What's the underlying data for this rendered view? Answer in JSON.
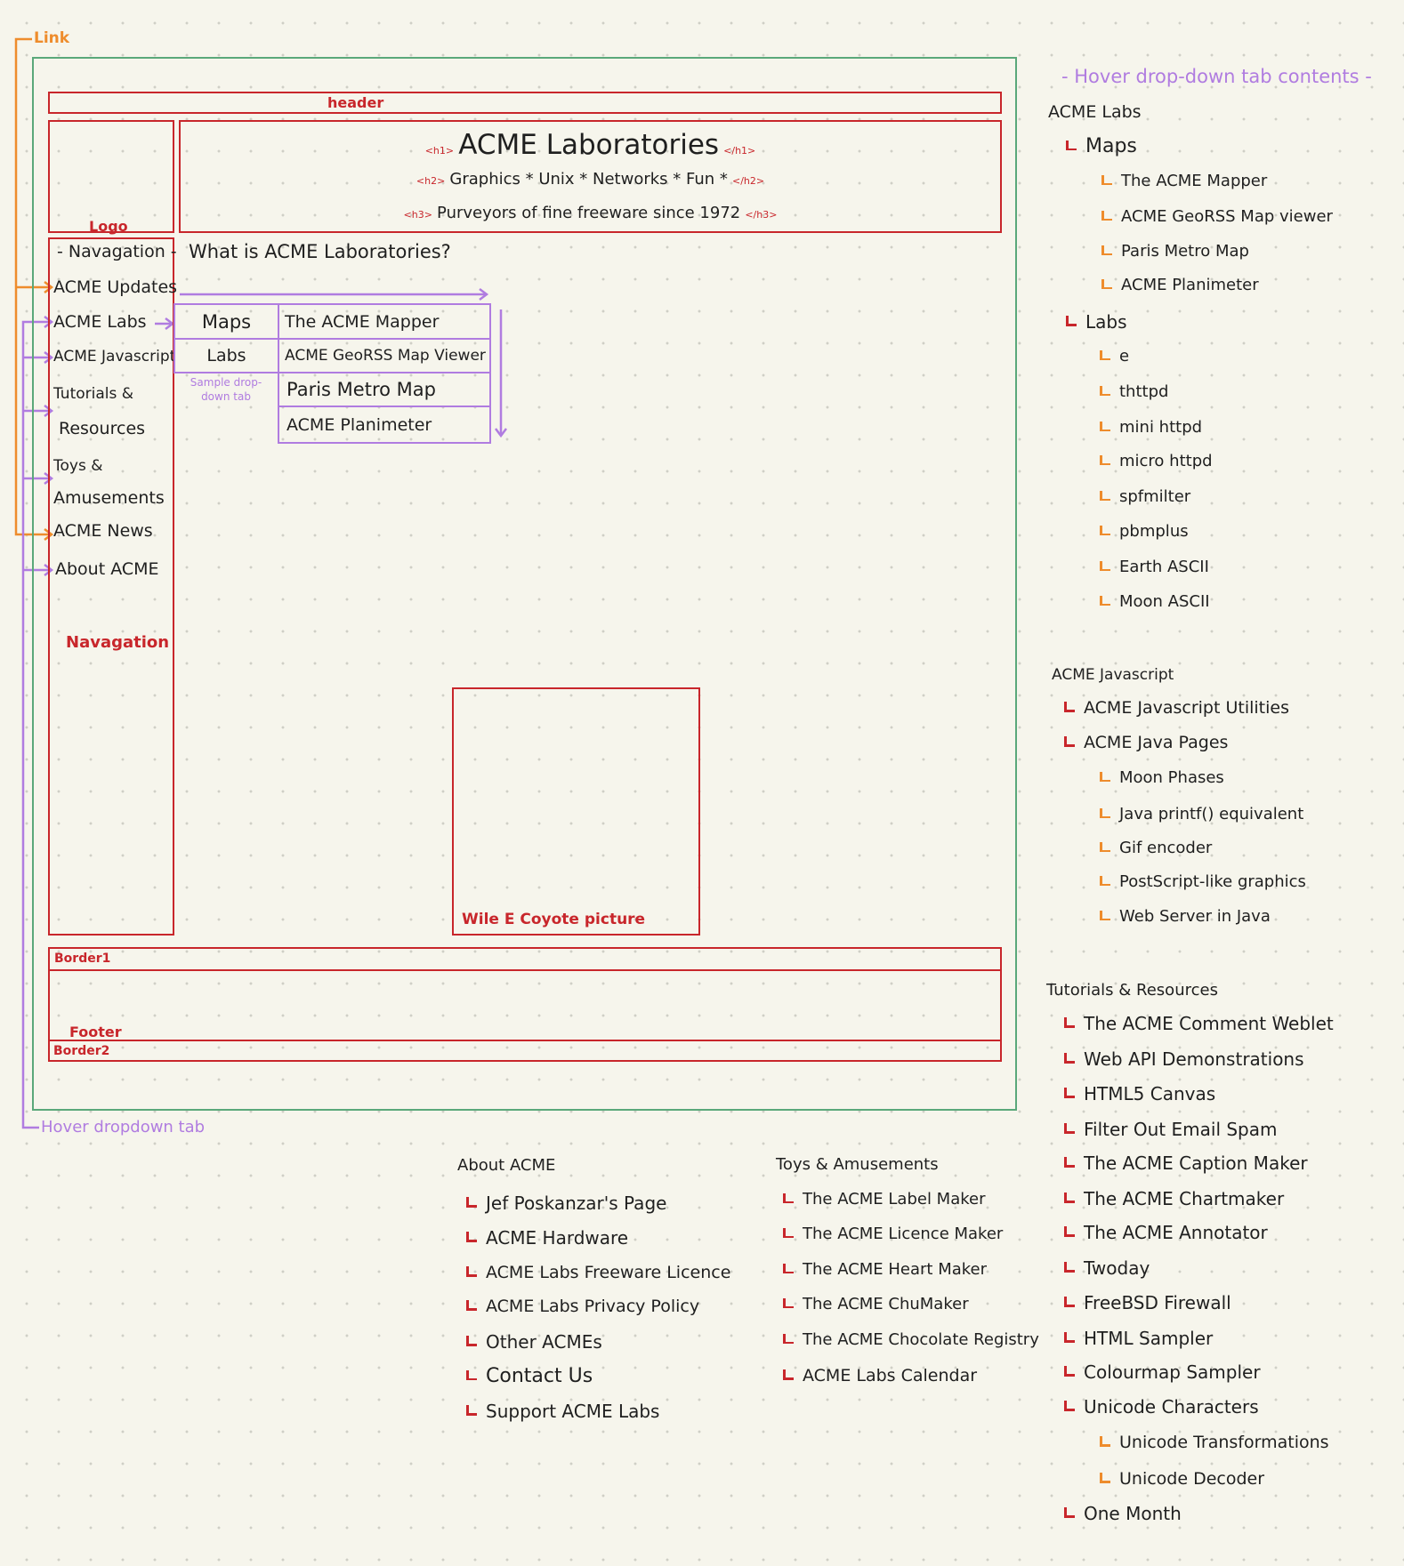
{
  "wireframe": {
    "annotations": {
      "link": "Link",
      "hover_dropdown_tab": "Hover dropdown tab",
      "sample_dropdown_tab": "Sample drop-down tab"
    },
    "regions": {
      "header": "header",
      "logo": "Logo",
      "navigation": "Navagation",
      "picture": "Wile E Coyote picture",
      "border1": "Border1",
      "footer": "Footer",
      "border2": "Border2"
    },
    "titles": {
      "h1_open": "<h1>",
      "h1": "ACME Laboratories",
      "h1_close": "</h1>",
      "h2_open": "<h2>",
      "h2": "Graphics * Unix * Networks * Fun *",
      "h2_close": "</h2>",
      "h3_open": "<h3>",
      "h3": "Purveyors of fine freeware since 1972",
      "h3_close": "</h3>"
    },
    "main_heading": "What is ACME Laboratories?",
    "nav": {
      "heading": "- Navagation -",
      "items": [
        "ACME Updates",
        "ACME Labs",
        "ACME Javascript",
        "Tutorials &",
        "Resources",
        "Toys &",
        "Amusements",
        "ACME News",
        "About ACME"
      ]
    },
    "dropdown_sample": {
      "categories": [
        "Maps",
        "Labs"
      ],
      "items": [
        "The ACME Mapper",
        "ACME GeoRSS Map Viewer",
        "Paris Metro Map",
        "ACME Planimeter"
      ]
    }
  },
  "hover_contents": {
    "title": "- Hover drop-down tab contents -",
    "acme_labs": {
      "title": "ACME Labs",
      "maps_label": "Maps",
      "maps": [
        "The ACME Mapper",
        "ACME GeoRSS Map viewer",
        "Paris Metro Map",
        "ACME Planimeter"
      ],
      "labs_label": "Labs",
      "labs": [
        "e",
        "thttpd",
        "mini httpd",
        "micro httpd",
        "spfmilter",
        "pbmplus",
        "Earth ASCII",
        "Moon ASCII"
      ]
    },
    "acme_javascript": {
      "title": "ACME Javascript",
      "items": [
        "ACME Javascript Utilities",
        "ACME Java Pages"
      ],
      "java_pages": [
        "Moon Phases",
        "Java printf() equivalent",
        "Gif encoder",
        "PostScript-like graphics",
        "Web Server in Java"
      ]
    },
    "tutorials": {
      "title": "Tutorials & Resources",
      "items": [
        "The ACME Comment Weblet",
        "Web API Demonstrations",
        "HTML5 Canvas",
        "Filter Out Email Spam",
        "The ACME Caption Maker",
        "The ACME Chartmaker",
        "The ACME Annotator",
        "Twoday",
        "FreeBSD Firewall",
        "HTML Sampler",
        "Colourmap Sampler",
        "Unicode Characters"
      ],
      "unicode_sub": [
        "Unicode Transformations",
        "Unicode Decoder"
      ],
      "last": "One Month"
    },
    "about": {
      "title": "About ACME",
      "items": [
        "Jef Poskanzar's Page",
        "ACME Hardware",
        "ACME Labs Freeware Licence",
        "ACME Labs Privacy Policy",
        "Other ACMEs",
        "Contact Us",
        "Support ACME Labs"
      ]
    },
    "toys": {
      "title": "Toys & Amusements",
      "items": [
        "The ACME Label Maker",
        "The ACME Licence Maker",
        "The ACME Heart Maker",
        "The ACME ChuMaker",
        "The ACME Chocolate Registry",
        "ACME Labs Calendar"
      ]
    }
  },
  "colors": {
    "region": "#c8262b",
    "page_frame": "#5aa87a",
    "link": "#ee8c2c",
    "hover": "#b07ce0"
  }
}
